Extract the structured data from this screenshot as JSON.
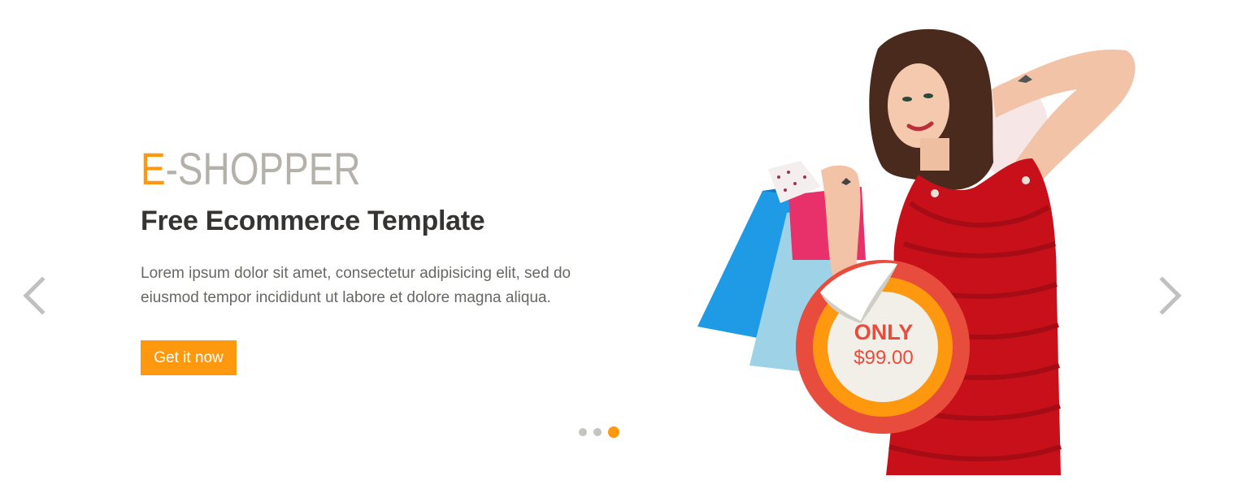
{
  "slide": {
    "brand_accent": "E",
    "brand_rest": "-SHOPPER",
    "headline": "Free Ecommerce Template",
    "description": "Lorem ipsum dolor sit amet, consectetur adipisicing elit, sed do eiusmod tempor incididunt ut labore et dolore magna aliqua.",
    "cta_label": "Get it now"
  },
  "badge": {
    "label": "ONLY",
    "price": "$99.00"
  },
  "carousel": {
    "slide_count": 3,
    "active_index": 2
  },
  "icons": {
    "prev": "chevron-left-icon",
    "next": "chevron-right-icon"
  },
  "colors": {
    "accent": "#fe980f",
    "brand_gray": "#b4b1ab",
    "headline": "#363432",
    "body_text": "#696763",
    "badge_red": "#e84c3d",
    "dot_inactive": "#c4c4c0"
  }
}
